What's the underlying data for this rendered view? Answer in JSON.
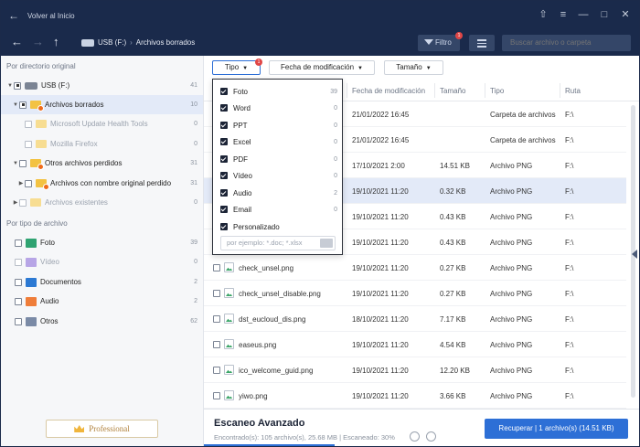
{
  "titlebar": {
    "back_label": "Volver al Inicio"
  },
  "nav": {
    "drive": "USB (F:)",
    "folder": "Archivos borrados",
    "filter_label": "Filtro",
    "filter_badge": "1",
    "search_placeholder": "Buscar archivo o carpeta"
  },
  "sidebar": {
    "by_dir_heading": "Por directorio original",
    "tree": [
      {
        "label": "USB (F:)",
        "count": "41"
      },
      {
        "label": "Archivos borrados",
        "count": "10"
      },
      {
        "label": "Microsoft Update Health Tools",
        "count": "0"
      },
      {
        "label": "Mozilla Firefox",
        "count": "0"
      },
      {
        "label": "Otros archivos perdidos",
        "count": "31"
      },
      {
        "label": "Archivos con nombre original perdido",
        "count": "31"
      },
      {
        "label": "Archivos existentes",
        "count": "0"
      }
    ],
    "by_type_heading": "Por tipo de archivo",
    "types": [
      {
        "label": "Foto",
        "count": "39",
        "color": "#2fa372"
      },
      {
        "label": "Vídeo",
        "count": "0",
        "color": "#9b7fd6"
      },
      {
        "label": "Documentos",
        "count": "2",
        "color": "#2c79d3"
      },
      {
        "label": "Audio",
        "count": "2",
        "color": "#ef7d3a"
      },
      {
        "label": "Otros",
        "count": "62",
        "color": "#7a8aa6"
      }
    ],
    "pro_label": "Professional"
  },
  "filters": {
    "type": "Tipo",
    "type_badge": "1",
    "modified": "Fecha de modificación",
    "size": "Tamaño"
  },
  "dropdown": {
    "items": [
      {
        "label": "Foto",
        "count": "39"
      },
      {
        "label": "Word",
        "count": "0"
      },
      {
        "label": "PPT",
        "count": "0"
      },
      {
        "label": "Excel",
        "count": "0"
      },
      {
        "label": "PDF",
        "count": "0"
      },
      {
        "label": "Vídeo",
        "count": "0"
      },
      {
        "label": "Audio",
        "count": "2"
      },
      {
        "label": "Email",
        "count": "0"
      },
      {
        "label": "Personalizado",
        "count": ""
      }
    ],
    "custom_placeholder": "por ejemplo: *.doc; *.xlsx"
  },
  "table": {
    "headers": {
      "modified": "Fecha de modificación",
      "size": "Tamaño",
      "type": "Tipo",
      "path": "Ruta"
    },
    "rows": [
      {
        "name": "",
        "modified": "21/01/2022 16:45",
        "size": "",
        "type": "Carpeta de archivos",
        "path": "F:\\"
      },
      {
        "name": "",
        "modified": "21/01/2022 16:45",
        "size": "",
        "type": "Carpeta de archivos",
        "path": "F:\\"
      },
      {
        "name": "",
        "modified": "17/10/2021 2:00",
        "size": "14.51 KB",
        "type": "Archivo PNG",
        "path": "F:\\"
      },
      {
        "name": "",
        "modified": "19/10/2021 11:20",
        "size": "0.32 KB",
        "type": "Archivo PNG",
        "path": "F:\\"
      },
      {
        "name": "",
        "modified": "19/10/2021 11:20",
        "size": "0.43 KB",
        "type": "Archivo PNG",
        "path": "F:\\"
      },
      {
        "name": "",
        "modified": "19/10/2021 11:20",
        "size": "0.43 KB",
        "type": "Archivo PNG",
        "path": "F:\\"
      },
      {
        "name": "check_unsel.png",
        "modified": "19/10/2021 11:20",
        "size": "0.27 KB",
        "type": "Archivo PNG",
        "path": "F:\\"
      },
      {
        "name": "check_unsel_disable.png",
        "modified": "19/10/2021 11:20",
        "size": "0.27 KB",
        "type": "Archivo PNG",
        "path": "F:\\"
      },
      {
        "name": "dst_eucloud_dis.png",
        "modified": "18/10/2021 11:20",
        "size": "7.17 KB",
        "type": "Archivo PNG",
        "path": "F:\\"
      },
      {
        "name": "easeus.png",
        "modified": "19/10/2021 11:20",
        "size": "4.54 KB",
        "type": "Archivo PNG",
        "path": "F:\\"
      },
      {
        "name": "ico_welcome_guid.png",
        "modified": "19/10/2021 11:20",
        "size": "12.20 KB",
        "type": "Archivo PNG",
        "path": "F:\\"
      },
      {
        "name": "yiwo.png",
        "modified": "19/10/2021 11:20",
        "size": "3.66 KB",
        "type": "Archivo PNG",
        "path": "F:\\"
      }
    ]
  },
  "bottom": {
    "title": "Escaneo Avanzado",
    "status": "Encontrado(s): 105 archivo(s), 25.68 MB | Escaneado: 30%",
    "progress": 0.3,
    "recover_label": "Recuperar | 1 archivo(s) (14.51 KB)"
  }
}
